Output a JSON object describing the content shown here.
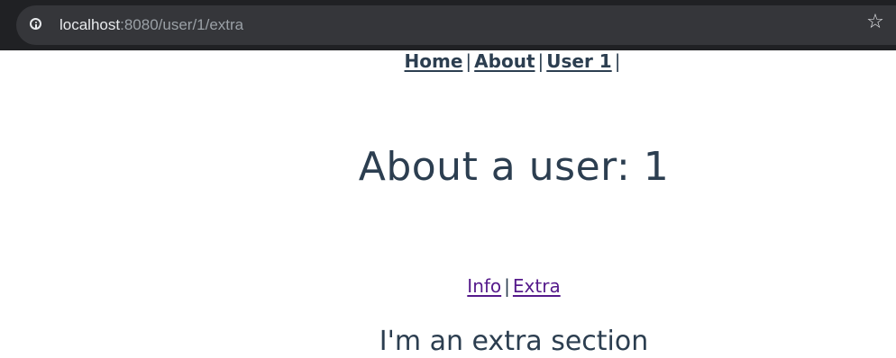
{
  "browser": {
    "url_host": "localhost",
    "url_path": ":8080/user/1/extra",
    "icons": {
      "site_info": "info-icon",
      "bookmark": "star-icon"
    }
  },
  "nav": {
    "home": "Home",
    "about": "About",
    "user": "User 1",
    "separator": "|"
  },
  "page": {
    "title": "About a user: 1"
  },
  "subnav": {
    "info": "Info",
    "extra": "Extra",
    "separator": "|"
  },
  "section": {
    "title": "I'm an extra section"
  },
  "colors": {
    "text": "#2c3e50",
    "visited_link": "#551a8b",
    "browser_bar": "#202124",
    "url_bar": "#35363a"
  }
}
